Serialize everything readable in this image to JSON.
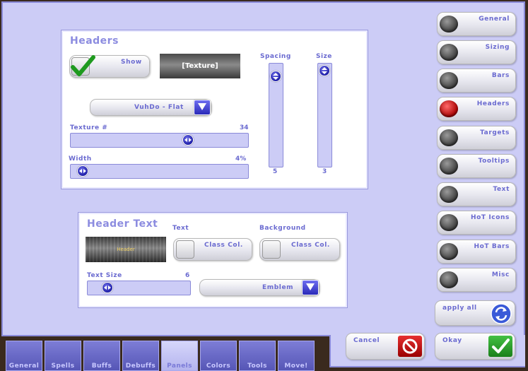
{
  "headers_panel": {
    "title": "Headers",
    "show_label": "Show",
    "show_checked": true,
    "texture_button": "[Texture]",
    "texture_dropdown": "VuhDo - Flat",
    "texture_num_label": "Texture #",
    "texture_num_value": "34",
    "width_label": "Width",
    "width_value": "4%",
    "spacing_label": "Spacing",
    "spacing_value": "5",
    "size_label": "Size",
    "size_value": "3"
  },
  "header_text_panel": {
    "title": "Header Text",
    "text_label": "Text",
    "text_button": "Class Col.",
    "background_label": "Background",
    "background_button": "Class Col.",
    "preview_text": "Header",
    "text_size_label": "Text Size",
    "text_size_value": "6",
    "font_dropdown": "Emblem"
  },
  "sidebar": {
    "items": [
      {
        "label": "General",
        "active": false
      },
      {
        "label": "Sizing",
        "active": false
      },
      {
        "label": "Bars",
        "active": false
      },
      {
        "label": "Headers",
        "active": true
      },
      {
        "label": "Targets",
        "active": false
      },
      {
        "label": "Tooltips",
        "active": false
      },
      {
        "label": "Text",
        "active": false
      },
      {
        "label": "HoT Icons",
        "active": false
      },
      {
        "label": "HoT Bars",
        "active": false
      },
      {
        "label": "Misc",
        "active": false
      }
    ],
    "apply_all": "apply all"
  },
  "actions": {
    "cancel": "Cancel",
    "okay": "Okay"
  },
  "tabs": [
    {
      "label": "General"
    },
    {
      "label": "Spells"
    },
    {
      "label": "Buffs"
    },
    {
      "label": "Debuffs"
    },
    {
      "label": "Panels",
      "active": true
    },
    {
      "label": "Colors"
    },
    {
      "label": "Tools"
    },
    {
      "label": "Move!"
    }
  ],
  "colors": {
    "accent": "#8c8ce0",
    "panel_bg": "#ccccf6",
    "active_orb": "#cc0000",
    "okay_green": "#1e9a1e",
    "cancel_red": "#c00000"
  }
}
